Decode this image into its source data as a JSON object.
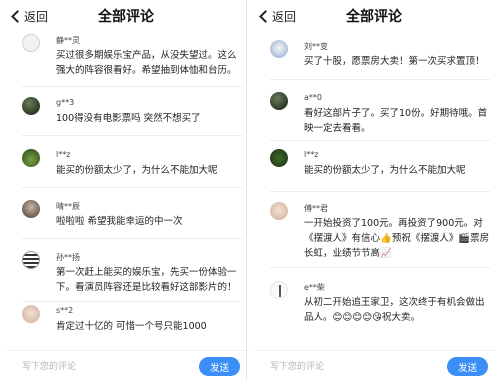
{
  "left": {
    "header": {
      "back_label": "返回",
      "title": "全部评论"
    },
    "comments": [
      {
        "name": "静**灵",
        "text": "买过很多期娱乐宝产品，从没失望过。这么强大的阵容很看好。希望抽到体恤和台历。",
        "avatar_icon": "sketch-face-avatar"
      },
      {
        "name": "g**3",
        "text": "100得没有电影票吗 突然不想买了",
        "avatar_icon": "dark-photo-avatar"
      },
      {
        "name": "l**z",
        "text": "能买的份额太少了，为什么不能加大呢",
        "avatar_icon": "green-field-avatar"
      },
      {
        "name": "晴**辰",
        "text": "啦啦啦 希望我能幸运的中一次",
        "avatar_icon": "portrait-avatar"
      },
      {
        "name": "孙**扬",
        "text": "第一次赶上能买的娱乐宝，先买一份体验一下。看演员阵容还是比较看好这部影片的！",
        "avatar_icon": "qr-pattern-avatar"
      },
      {
        "name": "s**2",
        "text": "肯定过十亿的 可惜一个号只能1000",
        "avatar_icon": "face-avatar"
      }
    ],
    "footer": {
      "placeholder": "写下您的评论",
      "send_label": "发送"
    }
  },
  "right": {
    "header": {
      "back_label": "返回",
      "title": "全部评论"
    },
    "comments": [
      {
        "name": "刘**变",
        "text": "买了十股，愿票房大卖！第一次买求置顶！",
        "avatar_icon": "blue-portrait-avatar"
      },
      {
        "name": "a**0",
        "text": "看好这部片子了。买了10份。好期待哦。首映一定去看看。",
        "avatar_icon": "dark-photo-avatar"
      },
      {
        "name": "l**z",
        "text": "能买的份额太少了，为什么不能加大呢",
        "avatar_icon": "green-field-avatar"
      },
      {
        "name": "傅**君",
        "text": "一开始投资了100元。再投资了900元。对《摆渡人》有信心👍预祝《摆渡人》🎬票房长虹，业绩节节高📈",
        "avatar_icon": "face-avatar"
      },
      {
        "name": "e**柴",
        "text": "从初二开始追王家卫，这次终于有机会做出品人。😊😊😊😊😘祝大卖。",
        "avatar_icon": "candle-avatar"
      }
    ],
    "footer": {
      "placeholder": "写下您的评论",
      "send_label": "发送"
    }
  }
}
